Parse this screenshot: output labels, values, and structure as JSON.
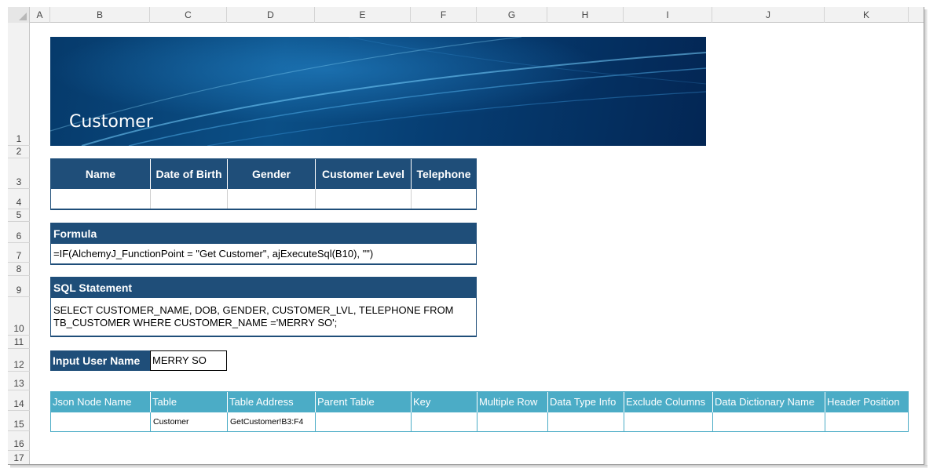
{
  "columns": [
    "A",
    "B",
    "C",
    "D",
    "E",
    "F",
    "G",
    "H",
    "I",
    "J",
    "K"
  ],
  "rows": [
    "1",
    "2",
    "3",
    "4",
    "5",
    "6",
    "7",
    "8",
    "9",
    "10",
    "11",
    "12",
    "13",
    "14",
    "15",
    "16",
    "17"
  ],
  "banner": {
    "title": "Customer"
  },
  "customer_table": {
    "headers": [
      "Name",
      "Date of Birth",
      "Gender",
      "Customer Level",
      "Telephone"
    ],
    "values": [
      "",
      "",
      "",
      "",
      ""
    ]
  },
  "formula": {
    "header": "Formula",
    "text": "=IF(AlchemyJ_FunctionPoint = \"Get Customer\", ajExecuteSql(B10), \"\")"
  },
  "sql": {
    "header": "SQL Statement",
    "line1": "SELECT CUSTOMER_NAME, DOB, GENDER, CUSTOMER_LVL, TELEPHONE FROM",
    "line2": "TB_CUSTOMER WHERE CUSTOMER_NAME ='MERRY SO';"
  },
  "input": {
    "label": "Input User Name",
    "value": "MERRY SO"
  },
  "mapping_table": {
    "headers": [
      "Json Node Name",
      "Table",
      "Table Address",
      "Parent Table",
      "Key",
      "Multiple Row",
      "Data Type Info",
      "Exclude Columns",
      "Data Dictionary Name",
      "Header Position"
    ],
    "values": [
      "",
      "Customer",
      "GetCustomer!B3:F4",
      "",
      "",
      "",
      "",
      "",
      "",
      ""
    ]
  },
  "colors": {
    "dark_header": "#1f4e79",
    "teal_header": "#4bacc6"
  }
}
